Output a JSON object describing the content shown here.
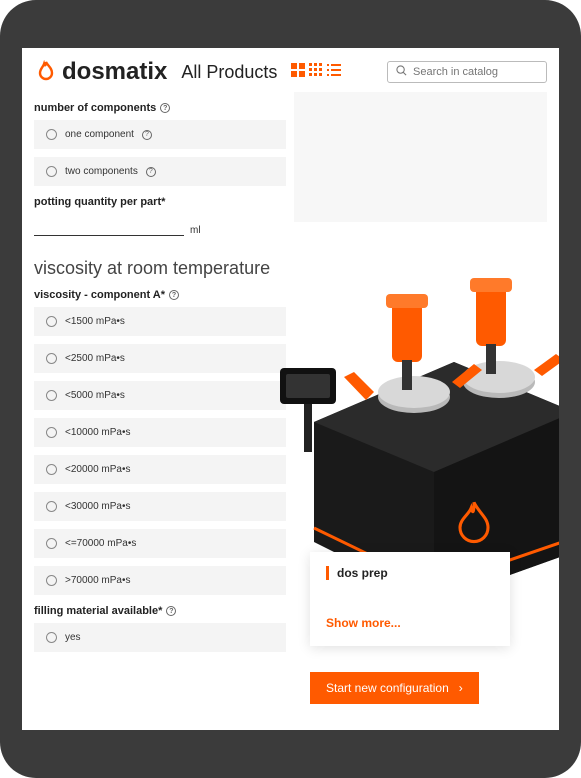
{
  "header": {
    "brand": "dosmatix",
    "nav_all_products": "All Products",
    "search_placeholder": "Search in catalog"
  },
  "form": {
    "components_label": "number of components",
    "components_options": [
      "one component",
      "two components"
    ],
    "potting_label": "potting quantity per part*",
    "potting_unit": "ml",
    "viscosity_section_title": "viscosity at room temperature",
    "viscosity_label": "viscosity - component A*",
    "viscosity_options": [
      "<1500 mPa•s",
      "<2500 mPa•s",
      "<5000 mPa•s",
      "<10000 mPa•s",
      "<20000 mPa•s",
      "<30000 mPa•s",
      "<=70000 mPa•s",
      ">70000 mPa•s"
    ],
    "filling_label": "filling material available*",
    "filling_options": [
      "yes"
    ]
  },
  "product": {
    "card_title": "dos prep",
    "show_more": "Show more...",
    "cta": "Start new configuration"
  },
  "colors": {
    "accent": "#ff5a00"
  }
}
